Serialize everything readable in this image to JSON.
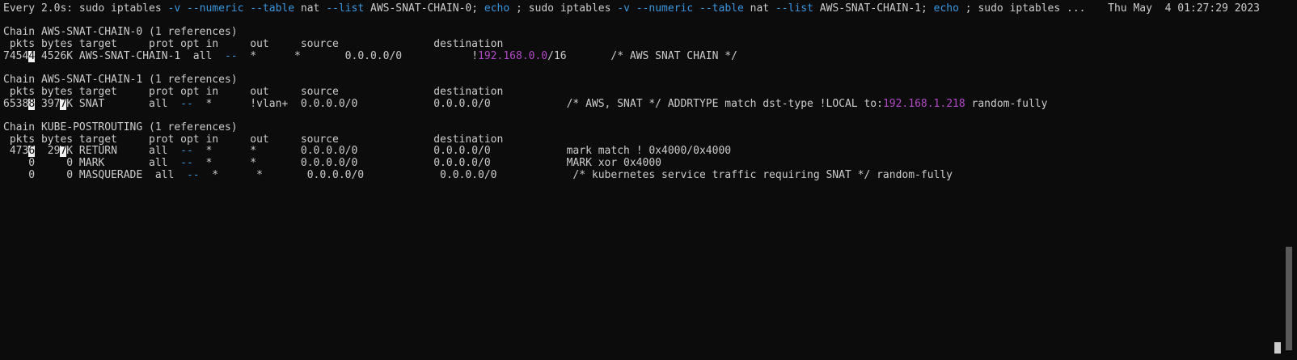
{
  "colors": {
    "background": "#0c0c0c",
    "text": "#cccccc",
    "flag": "#3a96dd",
    "ip": "#b148c6",
    "highlight": "#f2f2f2"
  },
  "header": {
    "watch_prefix": "Every 2.0s: sudo iptables ",
    "flag_v": "-v",
    "sp1": " ",
    "flag_numeric": "--numeric",
    "sp2": " ",
    "flag_table": "--table",
    "nat1": " nat ",
    "flag_list": "--list",
    "chain0": " AWS-SNAT-CHAIN-0; ",
    "echo1": "echo",
    "mid": " ; sudo iptables ",
    "flag_v2": "-v",
    "sp3": " ",
    "flag_numeric2": "--numeric",
    "sp4": " ",
    "flag_table2": "--table",
    "nat2": " nat ",
    "flag_list2": "--list",
    "chain1": " AWS-SNAT-CHAIN-1; ",
    "echo2": "echo",
    "tail": " ; sudo iptables ...",
    "timestamp": "Thu May  4 01:27:29 2023"
  },
  "chains": [
    {
      "title": "Chain AWS-SNAT-CHAIN-0 (1 references)",
      "columns": " pkts bytes target     prot opt in     out     source               destination",
      "rows": [
        {
          "pkts_a": "7454",
          "pkts_hl": "4",
          "rest1": " 4526K AWS-SNAT-CHAIN-1  all  ",
          "opt": "--",
          "rest2": "  *      *       0.0.0.0/0           !",
          "ip": "192.168.0.0",
          "rest3": "/16       /* AWS SNAT CHAIN */"
        }
      ]
    },
    {
      "title": "Chain AWS-SNAT-CHAIN-1 (1 references)",
      "columns": " pkts bytes target     prot opt in     out     source               destination",
      "rows": [
        {
          "pkts_a": "6538",
          "pkts_hl": "8",
          "bytes_a": " 397",
          "bytes_hl": "7",
          "rest1": "K SNAT       all  ",
          "opt": "--",
          "rest2": "  *      !vlan+  0.0.0.0/0            0.0.0.0/0            /* AWS, SNAT */ ADDRTYPE match dst-type !LOCAL to:",
          "ip": "192.168.1.218",
          "rest3": " random-fully"
        }
      ]
    },
    {
      "title": "Chain KUBE-POSTROUTING (1 references)",
      "columns": " pkts bytes target     prot opt in     out     source               destination",
      "rows": [
        {
          "pkts_a": " 473",
          "pkts_hl": "6",
          "bytes_a": "  29",
          "bytes_hl": "7",
          "rest1": "K RETURN     all  ",
          "opt": "--",
          "rest2": "  *      *       0.0.0.0/0            0.0.0.0/0            mark match ! 0x4000/0x4000"
        },
        {
          "lead": "    0     0 MARK       all  ",
          "opt": "--",
          "rest2": "  *      *       0.0.0.0/0            0.0.0.0/0            MARK xor 0x4000"
        },
        {
          "lead": "    0     0 MASQUERADE  all  ",
          "opt": "--",
          "rest2": "  *      *       0.0.0.0/0            0.0.0.0/0            /* kubernetes service traffic requiring SNAT */ random-fully"
        }
      ]
    }
  ]
}
